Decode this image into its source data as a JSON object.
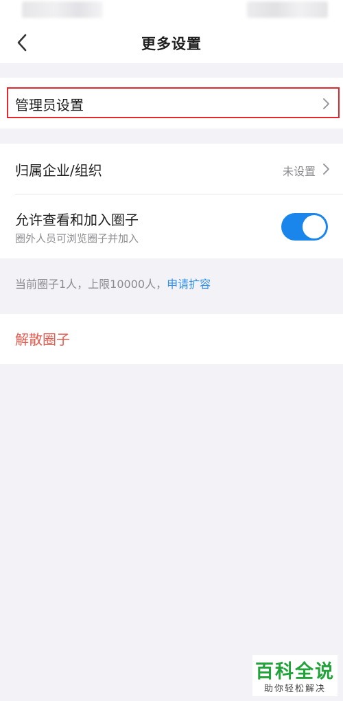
{
  "header": {
    "title": "更多设置",
    "back_icon": "chevron-left-icon"
  },
  "admin_section": {
    "label": "管理员设置"
  },
  "org_section": {
    "label": "归属企业/组织",
    "value": "未设置"
  },
  "circle_section": {
    "label": "允许查看和加入圈子",
    "description": "圈外人员可浏览圈子并加入",
    "toggle_on": true
  },
  "capacity": {
    "text": "当前圈子1人，上限10000人，",
    "link": "申请扩容"
  },
  "dissolve": {
    "label": "解散圈子"
  },
  "colors": {
    "accent_blue": "#1a86ec",
    "danger_red": "#e55a4e",
    "highlight_red": "#e0282c",
    "background": "#f3f3f7"
  },
  "watermark": {
    "title": "百科全说",
    "subtitle": "助你轻松解决"
  }
}
